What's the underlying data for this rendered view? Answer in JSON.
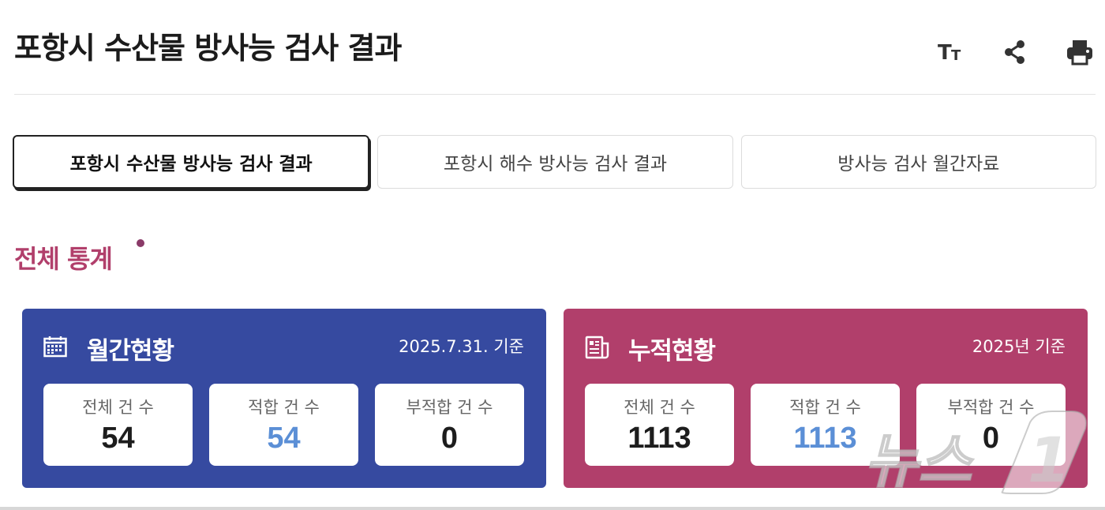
{
  "header": {
    "title": "포항시 수산물 방사능 검사 결과",
    "tools": [
      {
        "icon": "text-size-icon",
        "glyph": "TT"
      },
      {
        "icon": "share-icon"
      },
      {
        "icon": "print-icon"
      }
    ]
  },
  "tabs": [
    {
      "label": "포항시 수산물 방사능 검사 결과",
      "active": true
    },
    {
      "label": "포항시 해수 방사능 검사 결과",
      "active": false
    },
    {
      "label": "방사능 검사 월간자료",
      "active": false
    }
  ],
  "section": {
    "title": "전체 통계"
  },
  "panels": {
    "monthly": {
      "title": "월간현황",
      "date": "2025.7.31. 기준",
      "icon": "calendar-icon",
      "color": "#364aa0",
      "stats": [
        {
          "label": "전체 건 수",
          "value": "54"
        },
        {
          "label": "적합 건 수",
          "value": "54"
        },
        {
          "label": "부적합 건 수",
          "value": "0"
        }
      ]
    },
    "cumulative": {
      "title": "누적현황",
      "date": "2025년 기준",
      "icon": "document-icon",
      "color": "#b13f6b",
      "stats": [
        {
          "label": "전체 건 수",
          "value": "1113"
        },
        {
          "label": "적합 건 수",
          "value": "1113"
        },
        {
          "label": "부적합 건 수",
          "value": "0"
        }
      ]
    }
  },
  "colors": {
    "accent_blue": "#5b8fd6",
    "section_title": "#b13f6b"
  },
  "watermark": {
    "text": "뉴스1"
  }
}
